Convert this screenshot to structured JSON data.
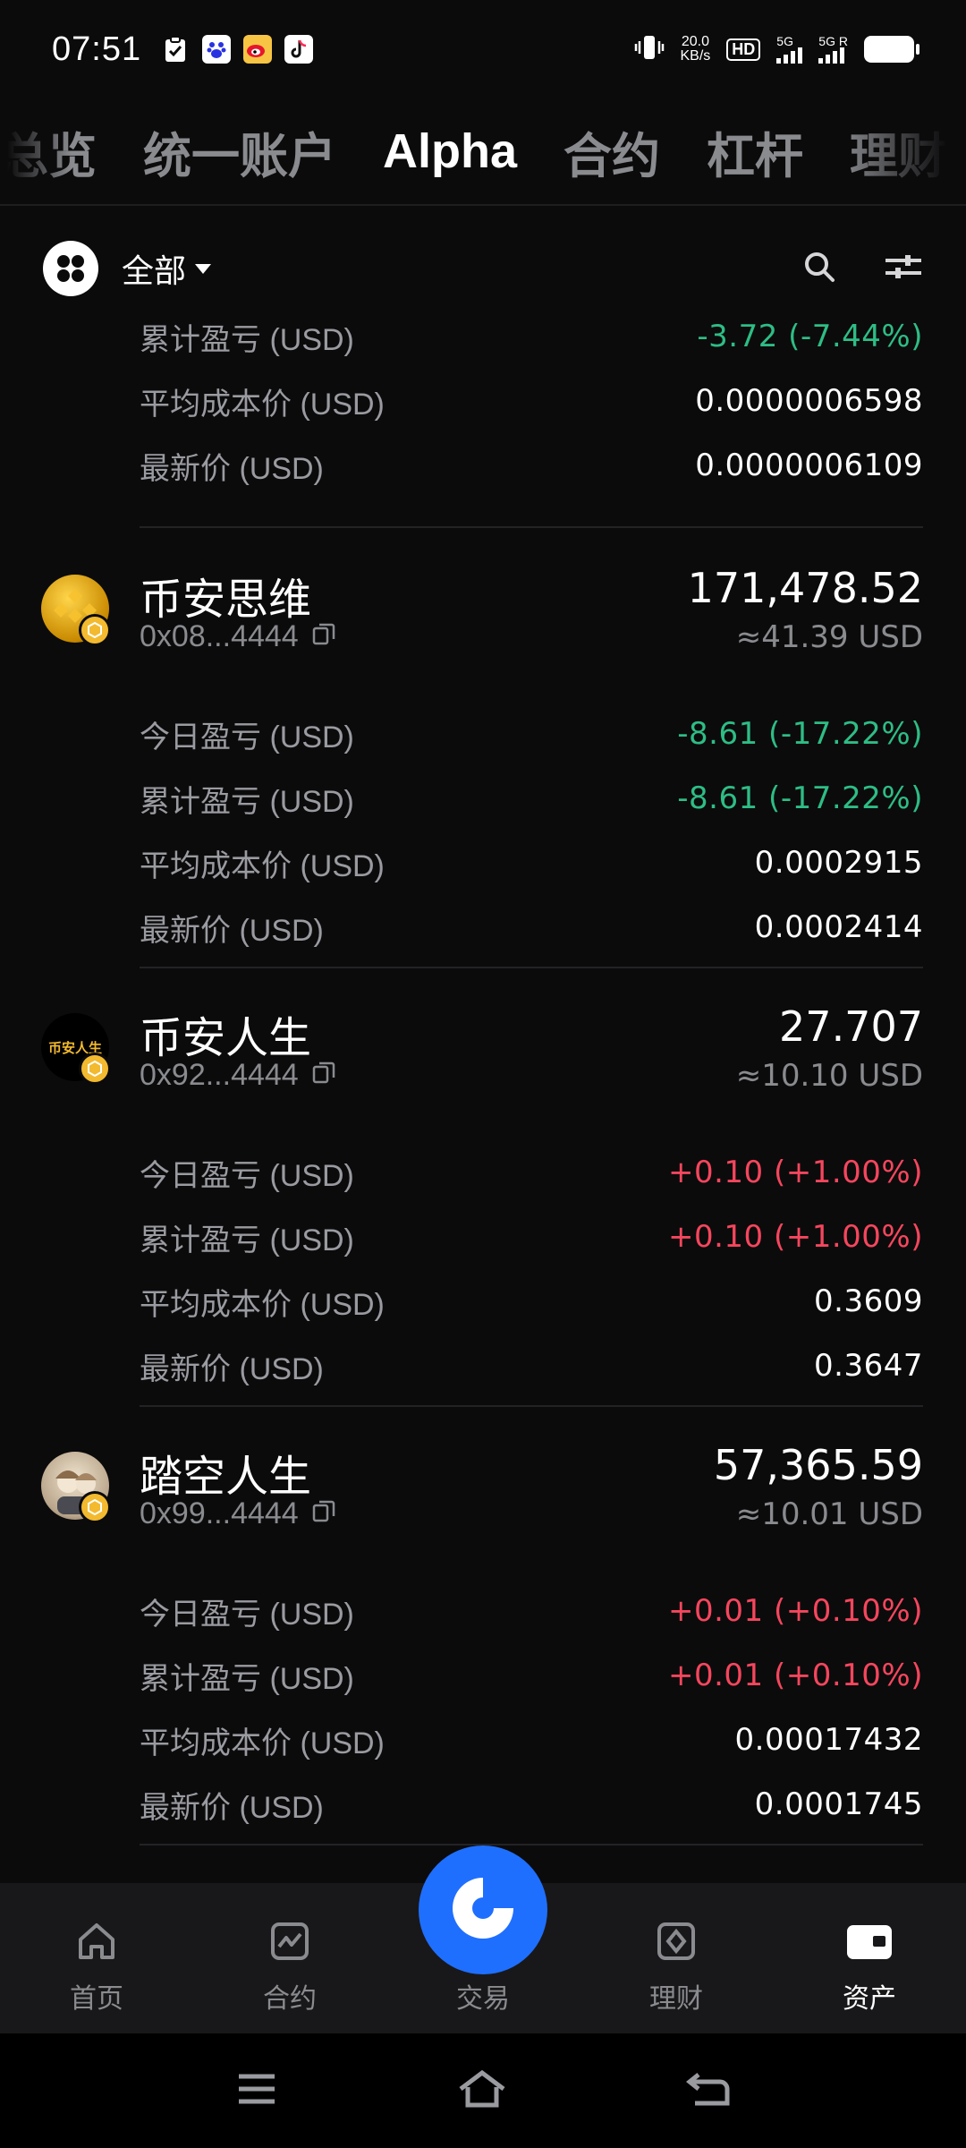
{
  "status_bar": {
    "time": "07:51",
    "net_speed_value": "20.0",
    "net_speed_unit": "KB/s",
    "hd": "HD",
    "sim1": "5G",
    "sim2": "5G",
    "sim2_roaming": "R"
  },
  "top_tabs": [
    {
      "label": "总览",
      "active": false
    },
    {
      "label": "统一账户",
      "active": false
    },
    {
      "label": "Alpha",
      "active": true
    },
    {
      "label": "合约",
      "active": false
    },
    {
      "label": "杠杆",
      "active": false
    },
    {
      "label": "理财",
      "active": false
    }
  ],
  "filter": {
    "label": "全部"
  },
  "partial_asset": {
    "rows": [
      {
        "label": "累计盈亏 (USD)",
        "value": "-3.72 (-7.44%)",
        "color": "green"
      },
      {
        "label": "平均成本价 (USD)",
        "value": "0.0000006598",
        "color": "white"
      },
      {
        "label": "最新价 (USD)",
        "value": "0.0000006109",
        "color": "white"
      }
    ]
  },
  "assets": [
    {
      "name": "币安思维",
      "address": "0x08...4444",
      "amount": "171,478.52",
      "usd": "≈41.39 USD",
      "rows": [
        {
          "label": "今日盈亏 (USD)",
          "value": "-8.61 (-17.22%)",
          "color": "green"
        },
        {
          "label": "累计盈亏 (USD)",
          "value": "-8.61 (-17.22%)",
          "color": "green"
        },
        {
          "label": "平均成本价 (USD)",
          "value": "0.0002915",
          "color": "white"
        },
        {
          "label": "最新价 (USD)",
          "value": "0.0002414",
          "color": "white"
        }
      ]
    },
    {
      "name": "币安人生",
      "address": "0x92...4444",
      "amount": "27.707",
      "usd": "≈10.10 USD",
      "avatar_text": "币安人生",
      "rows": [
        {
          "label": "今日盈亏 (USD)",
          "value": "+0.10 (+1.00%)",
          "color": "red"
        },
        {
          "label": "累计盈亏 (USD)",
          "value": "+0.10 (+1.00%)",
          "color": "red"
        },
        {
          "label": "平均成本价 (USD)",
          "value": "0.3609",
          "color": "white"
        },
        {
          "label": "最新价 (USD)",
          "value": "0.3647",
          "color": "white"
        }
      ]
    },
    {
      "name": "踏空人生",
      "address": "0x99...4444",
      "amount": "57,365.59",
      "usd": "≈10.01 USD",
      "rows": [
        {
          "label": "今日盈亏 (USD)",
          "value": "+0.01 (+0.10%)",
          "color": "red"
        },
        {
          "label": "累计盈亏 (USD)",
          "value": "+0.01 (+0.10%)",
          "color": "red"
        },
        {
          "label": "平均成本价 (USD)",
          "value": "0.00017432",
          "color": "white"
        },
        {
          "label": "最新价 (USD)",
          "value": "0.0001745",
          "color": "white"
        }
      ]
    }
  ],
  "bottom_nav": [
    {
      "label": "首页",
      "icon": "home-icon",
      "active": false
    },
    {
      "label": "合约",
      "icon": "futures-icon",
      "active": false
    },
    {
      "label": "交易",
      "icon": "trade-icon",
      "active": false
    },
    {
      "label": "理财",
      "icon": "earn-icon",
      "active": false
    },
    {
      "label": "资产",
      "icon": "wallet-icon",
      "active": true
    }
  ],
  "colors": {
    "background": "#0b0b0c",
    "positive_green": "#2ebd85",
    "negative_red": "#f6465d",
    "trade_blue": "#1f6fff",
    "muted_text": "#8a8b8f"
  }
}
